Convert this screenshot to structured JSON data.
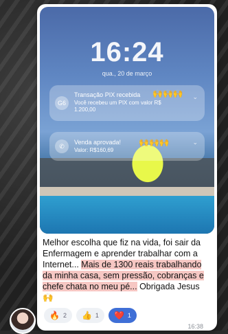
{
  "lock_screen": {
    "time": "16:24",
    "date": "qua., 20 de março"
  },
  "notifications": [
    {
      "icon": "pix-icon",
      "icon_text": "G6",
      "title": "Transação PIX recebida",
      "text": "Você recebeu um PIX com valor R$ 1.200,00",
      "emoji": "🙌🙌🙌"
    },
    {
      "icon": "phone-icon",
      "icon_text": "✆",
      "title": "Venda aprovada!",
      "text": "Valor: R$160,69",
      "emoji": "🙌🙌🙌"
    }
  ],
  "caption": {
    "part1": "Melhor escolha que fiz na vida, foi sair da Enfermagem e aprender trabalhar com a Internet... ",
    "highlight": "Mais de 1300 reais trabalhando da minha casa, sem pressão, cobranças e chefe chata no meu pé...",
    "part2": " Obrigada Jesus 🙌"
  },
  "reactions": [
    {
      "emoji": "🔥",
      "count": "2"
    },
    {
      "emoji": "👍",
      "count": "1"
    },
    {
      "emoji": "❤️",
      "count": "1"
    }
  ],
  "message_time": "16:38",
  "colors": {
    "highlight": "#f6c7c3",
    "active_reaction": "#3f6fd6"
  }
}
